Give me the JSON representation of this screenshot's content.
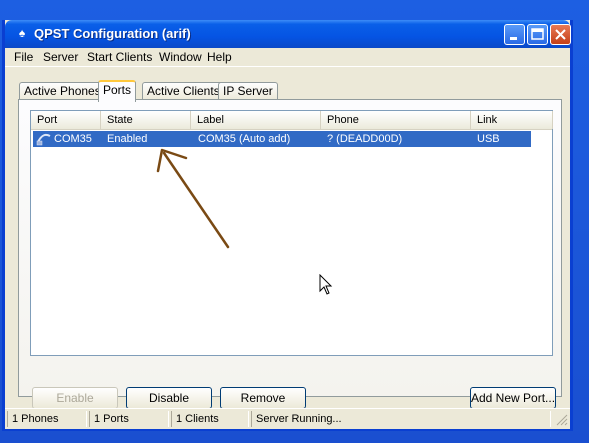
{
  "window": {
    "title": "QPST Configuration (arif)"
  },
  "titlebar_buttons": {
    "minimize_icon": "minimize-icon",
    "maximize_icon": "maximize-icon",
    "close_icon": "close-icon"
  },
  "menu": [
    "File",
    "Server",
    "Start Clients",
    "Window",
    "Help"
  ],
  "tabs": [
    "Active Phones",
    "Ports",
    "Active Clients",
    "IP Server"
  ],
  "active_tab": "Ports",
  "columns": [
    "Port",
    "State",
    "Label",
    "Phone",
    "Link"
  ],
  "rows": [
    {
      "port": "COM35",
      "state": "Enabled",
      "label": "COM35 (Auto add)",
      "phone": "? (DEADD00D)",
      "link": "USB",
      "selected": true,
      "icon": "serial-port-icon"
    }
  ],
  "buttons": {
    "enable": "Enable",
    "disable": "Disable",
    "remove": "Remove",
    "add_new_port": "Add New Port..."
  },
  "status": [
    "1 Phones",
    "1 Ports",
    "1 Clients",
    "Server Running..."
  ],
  "colors": {
    "selection": "#316ac5",
    "titlebar": "#0554e3",
    "annotation_arrow": "#7a4a14"
  }
}
